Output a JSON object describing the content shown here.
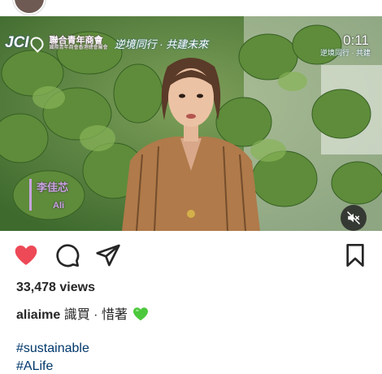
{
  "video": {
    "logo_text": "JCI",
    "org_name": "聯合青年商會",
    "org_sub": "國際青年商會香港總會屬會",
    "event_name": "逆境同行 · 共建未來",
    "timer": "0:11",
    "badge": "逆境同行 · 共建",
    "speaker_name_zh": "李佳芯",
    "speaker_name_en": "Ali",
    "accent_color": "#c9a3e0"
  },
  "actions": {
    "like_icon": "heart-filled-icon",
    "like_color": "#ed4956",
    "comment_icon": "comment-icon",
    "share_icon": "send-icon",
    "save_icon": "bookmark-icon",
    "mute_icon": "speaker-muted-icon"
  },
  "post": {
    "views": "33,478 views",
    "username": "aliaime",
    "caption_text": "識買 · 惜著",
    "emoji": "green-heart",
    "hashtags": [
      "#sustainable",
      "#ALife"
    ]
  }
}
